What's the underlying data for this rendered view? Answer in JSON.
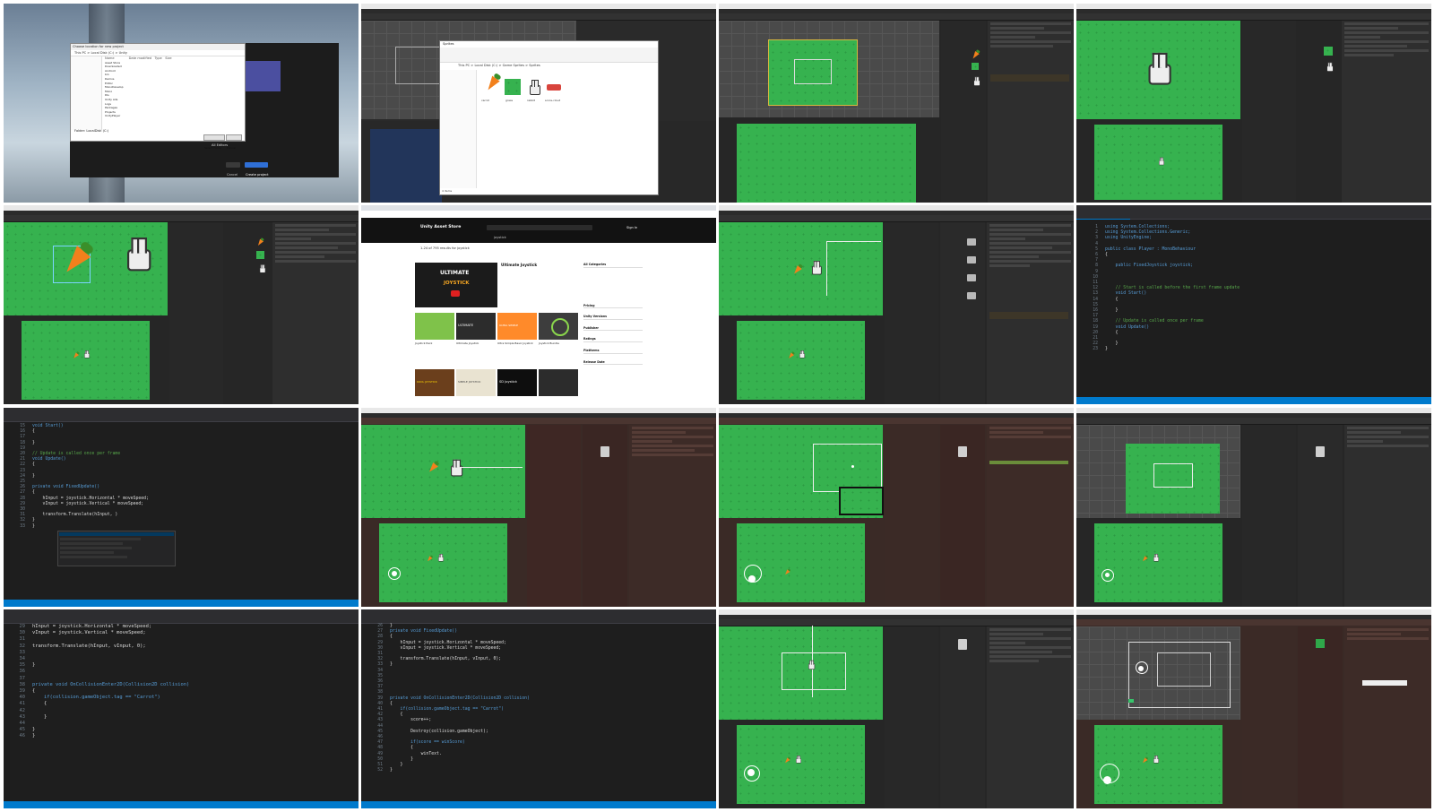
{
  "tile1": {
    "dialog_title": "Choose location for new project",
    "dialog_path": "This PC > Local Disk (C:) > Unity",
    "columns": [
      "Name",
      "Date modified",
      "Type",
      "Size"
    ],
    "folders": [
      "Asset Store",
      "Downloaded",
      "Android",
      "bin",
      "Demos",
      "Editor",
      "MonoDevelop",
      "Mono",
      "Dls",
      "Unity Ads",
      "Logs",
      "Packages",
      "Projects",
      "UnityPlayer"
    ],
    "folder_label": "Folder: LocalDisk (C:)",
    "select_button": "Select Folder",
    "cancel_button": "Cancel",
    "create_button": "Create project",
    "cancel_button_2": "Cancel",
    "template_label": "All Editors"
  },
  "tile2": {
    "window_title": "Sprites",
    "path": "This PC > Local Disk (C:) > Game Sprites > Sprites",
    "files": [
      "carrot",
      "grass",
      "rabbit",
      "score-cloud"
    ],
    "status": "4 items"
  },
  "tile6": {
    "store_name": "Unity Asset Store",
    "search_value": "joystick",
    "nav": [
      "3D",
      "2D",
      "Add-Ons",
      "Audio",
      "AI",
      "Decentralization",
      "Essentials",
      "Templates",
      "Tools",
      "VFX",
      "Sale"
    ],
    "results_count": "1-24 of 795 results for joystick",
    "featured_title": "Ultimate Joystick",
    "featured_banner": "ULTIMATE",
    "featured_sub": "JOYSTICK",
    "card_titles": [
      "Joystick Pack",
      "Ultimate Joystick",
      "Ultra Simple Basic Joystick",
      "Joystick Bundle"
    ],
    "card_banners": [
      "ULTIMATE",
      "ULTRA SIMPLE",
      "",
      ""
    ],
    "row3_titles": [
      "SIMPLE JOYSTICK",
      "SD Joystick",
      "KOOL JOYSTICK"
    ],
    "filters": [
      "All Categories",
      "Pricing",
      "Unity Versions",
      "Publisher",
      "Ratings",
      "Platforms",
      "Release Date"
    ],
    "sign_in": "Sign In"
  },
  "tile8": {
    "lines": [
      {
        "n": "1",
        "t": "using System.Collections;"
      },
      {
        "n": "2",
        "t": "using System.Collections.Generic;"
      },
      {
        "n": "3",
        "t": "using UnityEngine;"
      },
      {
        "n": "4",
        "t": ""
      },
      {
        "n": "5",
        "t": "public class Player : MonoBehaviour"
      },
      {
        "n": "6",
        "t": "{"
      },
      {
        "n": "7",
        "t": ""
      },
      {
        "n": "8",
        "t": "    public FixedJoystick joystick;"
      },
      {
        "n": "9",
        "t": ""
      },
      {
        "n": "10",
        "t": ""
      },
      {
        "n": "11",
        "t": ""
      },
      {
        "n": "12",
        "t": "    // Start is called before the first frame update"
      },
      {
        "n": "13",
        "t": "    void Start()"
      },
      {
        "n": "14",
        "t": "    {"
      },
      {
        "n": "15",
        "t": ""
      },
      {
        "n": "16",
        "t": "    }"
      },
      {
        "n": "17",
        "t": ""
      },
      {
        "n": "18",
        "t": "    // Update is called once per frame"
      },
      {
        "n": "19",
        "t": "    void Update()"
      },
      {
        "n": "20",
        "t": "    {"
      },
      {
        "n": "21",
        "t": ""
      },
      {
        "n": "22",
        "t": "    }"
      },
      {
        "n": "23",
        "t": "}"
      }
    ]
  },
  "tile9": {
    "lines": [
      {
        "n": "15",
        "t": "void Start()"
      },
      {
        "n": "16",
        "t": "{"
      },
      {
        "n": "17",
        "t": ""
      },
      {
        "n": "18",
        "t": "}"
      },
      {
        "n": "19",
        "t": ""
      },
      {
        "n": "20",
        "t": "// Update is called once per frame"
      },
      {
        "n": "21",
        "t": "void Update()"
      },
      {
        "n": "22",
        "t": "{"
      },
      {
        "n": "23",
        "t": ""
      },
      {
        "n": "24",
        "t": "}"
      },
      {
        "n": "25",
        "t": ""
      },
      {
        "n": "26",
        "t": "private void FixedUpdate()"
      },
      {
        "n": "27",
        "t": "{"
      },
      {
        "n": "28",
        "t": "    hInput = joystick.Horizontal * moveSpeed;"
      },
      {
        "n": "29",
        "t": "    vInput = joystick.Vertical * moveSpeed;"
      },
      {
        "n": "30",
        "t": ""
      },
      {
        "n": "31",
        "t": "    transform.Translate(hInput, )"
      },
      {
        "n": "32",
        "t": "}"
      },
      {
        "n": "33",
        "t": "}"
      }
    ]
  },
  "tile13": {
    "lines": [
      {
        "n": "29",
        "t": "hInput = joystick.Horizontal * moveSpeed;"
      },
      {
        "n": "30",
        "t": "vInput = joystick.Vertical * moveSpeed;"
      },
      {
        "n": "31",
        "t": ""
      },
      {
        "n": "32",
        "t": "transform.Translate(hInput, vInput, 0);"
      },
      {
        "n": "33",
        "t": ""
      },
      {
        "n": "34",
        "t": ""
      },
      {
        "n": "35",
        "t": "}"
      },
      {
        "n": "36",
        "t": ""
      },
      {
        "n": "37",
        "t": ""
      },
      {
        "n": "38",
        "t": "private void OnCollisionEnter2D(Collision2D collision)"
      },
      {
        "n": "39",
        "t": "{"
      },
      {
        "n": "40",
        "t": "    if(collision.gameObject.tag == \"Carrot\")"
      },
      {
        "n": "41",
        "t": "    {"
      },
      {
        "n": "42",
        "t": ""
      },
      {
        "n": "43",
        "t": "    }"
      },
      {
        "n": "44",
        "t": ""
      },
      {
        "n": "45",
        "t": "}"
      },
      {
        "n": "46",
        "t": "}"
      }
    ]
  },
  "tile14": {
    "lines": [
      {
        "n": "26",
        "t": "}"
      },
      {
        "n": "27",
        "t": "private void FixedUpdate()"
      },
      {
        "n": "28",
        "t": "{"
      },
      {
        "n": "29",
        "t": "    hInput = joystick.Horizontal * moveSpeed;"
      },
      {
        "n": "30",
        "t": "    vInput = joystick.Vertical * moveSpeed;"
      },
      {
        "n": "31",
        "t": ""
      },
      {
        "n": "32",
        "t": "    transform.Translate(hInput, vInput, 0);"
      },
      {
        "n": "33",
        "t": "}"
      },
      {
        "n": "34",
        "t": ""
      },
      {
        "n": "35",
        "t": ""
      },
      {
        "n": "36",
        "t": ""
      },
      {
        "n": "37",
        "t": ""
      },
      {
        "n": "38",
        "t": ""
      },
      {
        "n": "39",
        "t": "private void OnCollisionEnter2D(Collision2D collision)"
      },
      {
        "n": "40",
        "t": "{"
      },
      {
        "n": "41",
        "t": "    if(collision.gameObject.tag == \"Carrot\")"
      },
      {
        "n": "42",
        "t": "    {"
      },
      {
        "n": "43",
        "t": "        score++;"
      },
      {
        "n": "44",
        "t": ""
      },
      {
        "n": "45",
        "t": "        Destroy(collision.gameObject);"
      },
      {
        "n": "46",
        "t": ""
      },
      {
        "n": "47",
        "t": "        if(score == winScore)"
      },
      {
        "n": "48",
        "t": "        {"
      },
      {
        "n": "49",
        "t": "            winText."
      },
      {
        "n": "50",
        "t": "        }"
      },
      {
        "n": "51",
        "t": "    }"
      },
      {
        "n": "52",
        "t": "}"
      }
    ]
  }
}
